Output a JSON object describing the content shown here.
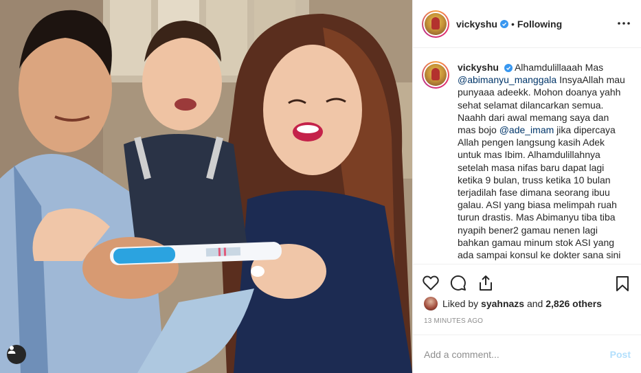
{
  "post": {
    "username": "vickyshu",
    "follow_separator": "•",
    "follow_status": "Following",
    "more_label": "•••"
  },
  "caption": {
    "username": "vickyshu",
    "text_before": "Alhamdulillaaah Mas",
    "mention_1": "@abimanyu_manggala",
    "text_middle": "InsyaAllah mau punyaaa adeekk. Mohon doanya yahh sehat selamat dilancarkan semua. Naahh dari awal memang saya dan mas bojo",
    "mention_2": "@ade_imam",
    "text_after": "jika dipercaya Allah pengen langsung kasih Adek untuk mas Ibim. Alhamdulillahnya setelah masa nifas baru dapat lagi ketika 9 bulan, truss ketika 10 bulan terjadilah fase dimana seorang ibuu galau. ASI yang biasa melimpah ruah turun drastis. Mas Abimanyu tiba tiba nyapih bener2 gamau nenen lagi bahkan gamau minum stok ASI yang ada sampai konsul ke dokter sana sini"
  },
  "likes": {
    "prefix": "Liked by",
    "liker": "syahnazs",
    "conjunction": "and",
    "count": "2,826 others"
  },
  "timestamp": "13 MINUTES AGO",
  "comment": {
    "placeholder": "Add a comment...",
    "post_label": "Post"
  },
  "colors": {
    "accent": "#3897f0",
    "mention": "#003569",
    "muted": "#8e8e8e",
    "post_disabled": "#b2dffc",
    "border": "#efefef"
  },
  "icons": {
    "like": "heart-icon",
    "comment": "comment-icon",
    "share": "share-icon",
    "save": "bookmark-icon",
    "more": "more-options-icon",
    "verified": "verified-badge-icon",
    "tagged_users": "user-tag-icon"
  }
}
